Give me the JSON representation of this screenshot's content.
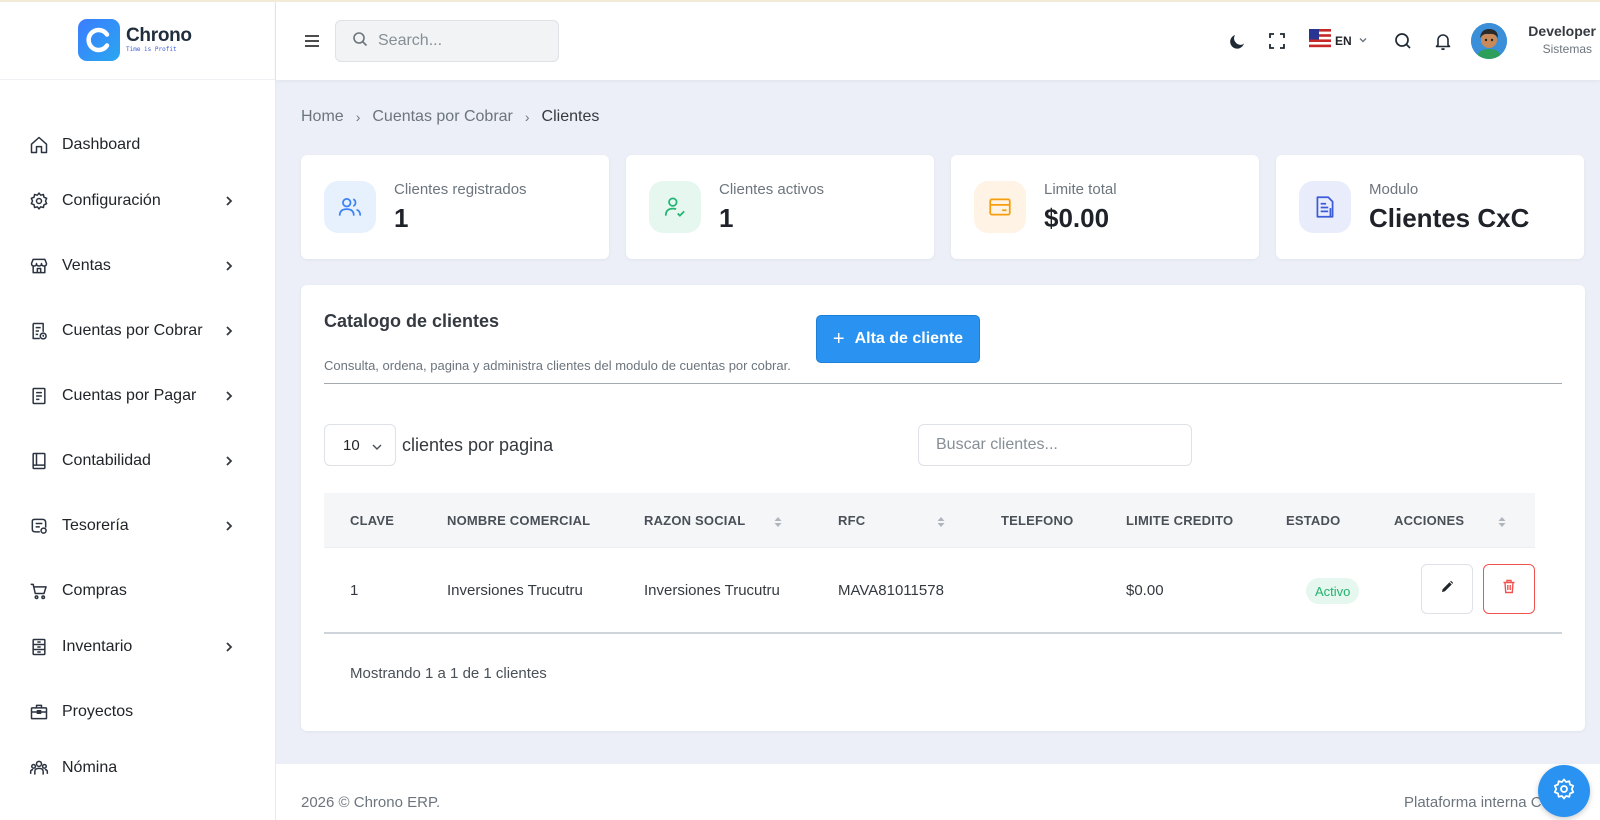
{
  "app": {
    "name": "Chrono",
    "tagline": "Time is Profit"
  },
  "header": {
    "search_placeholder": "Search...",
    "language": "EN",
    "user_name": "Developer",
    "user_role": "Sistemas"
  },
  "sidebar": {
    "items": [
      {
        "label": "Dashboard",
        "icon": "home-icon",
        "has_submenu": false
      },
      {
        "label": "Configuración",
        "icon": "gear-icon",
        "has_submenu": true
      },
      {
        "label": "Ventas",
        "icon": "store-icon",
        "has_submenu": true
      },
      {
        "label": "Cuentas por Cobrar",
        "icon": "receipt-icon",
        "has_submenu": true
      },
      {
        "label": "Cuentas por Pagar",
        "icon": "document-icon",
        "has_submenu": true
      },
      {
        "label": "Contabilidad",
        "icon": "book-icon",
        "has_submenu": true
      },
      {
        "label": "Tesorería",
        "icon": "coins-icon",
        "has_submenu": true
      },
      {
        "label": "Compras",
        "icon": "cart-icon",
        "has_submenu": false
      },
      {
        "label": "Inventario",
        "icon": "inventory-icon",
        "has_submenu": true
      },
      {
        "label": "Proyectos",
        "icon": "briefcase-icon",
        "has_submenu": false
      },
      {
        "label": "Nómina",
        "icon": "users-icon",
        "has_submenu": false
      }
    ]
  },
  "breadcrumb": {
    "items": [
      "Home",
      "Cuentas por Cobrar",
      "Clientes"
    ],
    "separator": "›"
  },
  "stats": [
    {
      "label": "Clientes registrados",
      "value": "1",
      "icon": "users-icon",
      "color": "#3b82f6"
    },
    {
      "label": "Clientes activos",
      "value": "1",
      "icon": "user-check-icon",
      "color": "#22b573"
    },
    {
      "label": "Limite total",
      "value": "$0.00",
      "icon": "credit-card-icon",
      "color": "#f59e0b"
    },
    {
      "label": "Modulo",
      "value": "Clientes CxC",
      "icon": "file-text-icon",
      "color": "#3b5bdb"
    }
  ],
  "catalog": {
    "title": "Catalogo de clientes",
    "subtitle": "Consulta, ordena, pagina y administra clientes del modulo de cuentas por cobrar.",
    "add_button": "Alta de cliente",
    "page_size": "10",
    "page_size_label": "clientes por pagina",
    "search_placeholder": "Buscar clientes...",
    "columns": [
      "CLAVE",
      "NOMBRE COMERCIAL",
      "RAZON SOCIAL",
      "RFC",
      "TELEFONO",
      "LIMITE CREDITO",
      "ESTADO",
      "ACCIONES"
    ],
    "rows": [
      {
        "clave": "1",
        "nombre_comercial": "Inversiones Trucutru",
        "razon_social": "Inversiones Trucutru",
        "rfc": "MAVA81011578",
        "telefono": "",
        "limite_credito": "$0.00",
        "estado": "Activo"
      }
    ],
    "showing": "Mostrando 1 a 1 de 1 clientes"
  },
  "footer": {
    "left": "2026 © Chrono ERP.",
    "right": "Plataforma interna C"
  },
  "colors": {
    "primary": "#2a92f0",
    "danger": "#ef5350",
    "success": "#23b26d",
    "background": "#eceff7"
  }
}
